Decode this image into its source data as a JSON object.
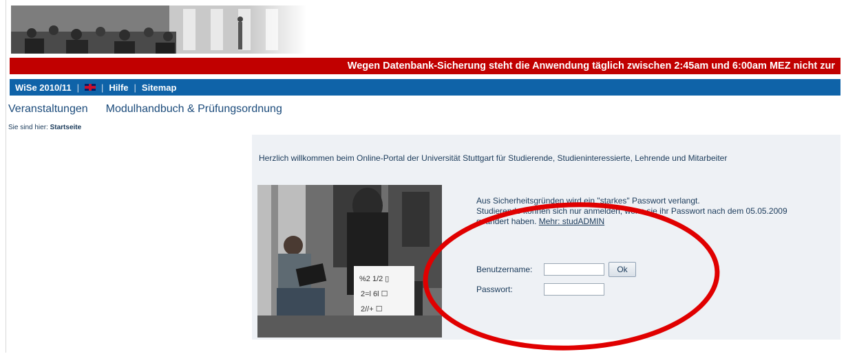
{
  "notice": {
    "text": "Wegen Datenbank-Sicherung steht die Anwendung täglich zwischen 2:45am und 6:00am MEZ nicht zur"
  },
  "nav": {
    "semester": "WiSe 2010/11",
    "separator": "|",
    "help": "Hilfe",
    "sitemap": "Sitemap"
  },
  "menu": {
    "courses": "Veranstaltungen",
    "module": "Modulhandbuch & Prüfungsordnung"
  },
  "breadcrumb": {
    "prefix": "Sie sind hier:",
    "current": "Startseite"
  },
  "welcome": "Herzlich willkommen beim Online-Portal der Universität Stuttgart für Studierende, Studieninteressierte, Lehrende und Mitarbeiter",
  "login": {
    "notice_line1": "Aus Sicherheitsgründen wird ein \"starkes\" Passwort verlangt.",
    "notice_line2": "Studierende können sich nur anmelden, wenn sie ihr Passwort nach dem 05.05.2009",
    "notice_line3": "geändert haben.",
    "more_link": "Mehr: studADMIN",
    "username_label": "Benutzername:",
    "password_label": "Passwort:",
    "username_value": "",
    "password_value": "",
    "ok_label": "Ok"
  },
  "colors": {
    "banner_red": "#c10000",
    "nav_blue": "#0f63a8",
    "annotation_red": "#e00000"
  },
  "icons": {
    "language_flag": "uk-flag-icon"
  }
}
